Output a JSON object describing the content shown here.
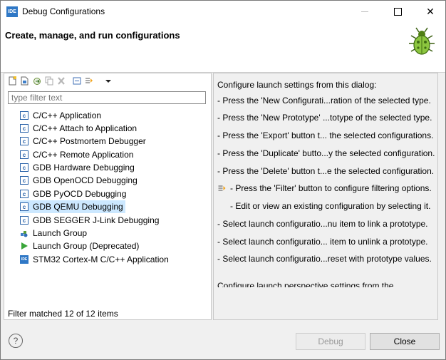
{
  "window": {
    "title": "Debug Configurations",
    "app_badge": "IDE",
    "minimize_symbol": "—",
    "maximize_symbol": "☐",
    "close_symbol": "✕"
  },
  "header": {
    "title": "Create, manage, and run configurations",
    "icon": "bug-icon"
  },
  "toolbar": {
    "icons": [
      "new-configuration-icon",
      "new-prototype-icon",
      "export-icon",
      "duplicate-icon",
      "delete-icon",
      "collapse-all-icon",
      "filter-icon",
      "view-menu-icon"
    ]
  },
  "filter": {
    "placeholder": "type filter text",
    "value": ""
  },
  "tree": {
    "items": [
      {
        "label": "C/C++ Application",
        "icon": "c-icon"
      },
      {
        "label": "C/C++ Attach to Application",
        "icon": "c-icon"
      },
      {
        "label": "C/C++ Postmortem Debugger",
        "icon": "c-icon"
      },
      {
        "label": "C/C++ Remote Application",
        "icon": "c-icon"
      },
      {
        "label": "GDB Hardware Debugging",
        "icon": "c-icon"
      },
      {
        "label": "GDB OpenOCD Debugging",
        "icon": "c-icon"
      },
      {
        "label": "GDB PyOCD Debugging",
        "icon": "c-icon"
      },
      {
        "label": "GDB QEMU Debugging",
        "icon": "c-icon",
        "selected": true
      },
      {
        "label": "GDB SEGGER J-Link Debugging",
        "icon": "c-icon"
      },
      {
        "label": "Launch Group",
        "icon": "launch-group-icon"
      },
      {
        "label": "Launch Group (Deprecated)",
        "icon": "play-icon"
      },
      {
        "label": "STM32 Cortex-M C/C++ Application",
        "icon": "ide-icon"
      }
    ]
  },
  "status": "Filter matched 12 of 12 items",
  "help": {
    "intro": "Configure launch settings from this dialog:",
    "lines": [
      "- Press the 'New Configurati...ration of the selected type.",
      "- Press the 'New Prototype' ...totype of the selected type.",
      "- Press the 'Export' button t... the selected configurations.",
      "- Press the 'Duplicate' butto...y the selected configuration.",
      "- Press the 'Delete' button t...e the selected configuration.",
      "- Press the 'Filter' button to configure filtering options.",
      "- Edit or view an existing configuration by selecting it.",
      "- Select launch configuratio...nu item to link a prototype.",
      "- Select launch configuratio... item to unlink a prototype.",
      "- Select launch configuratio...reset with prototype values."
    ],
    "partial": "Configure launch perspective settings from the"
  },
  "footer": {
    "help_symbol": "?",
    "debug_label": "Debug",
    "close_label": "Close"
  }
}
